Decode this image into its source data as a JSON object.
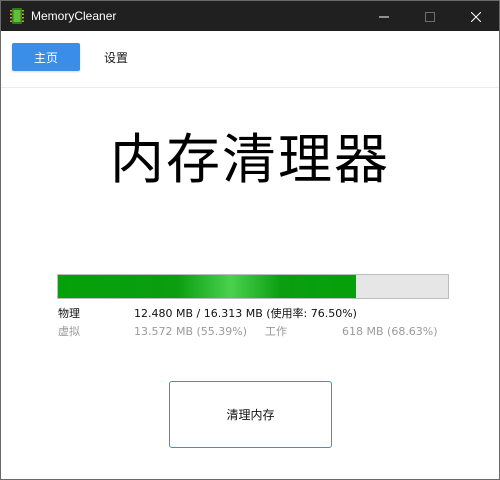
{
  "window": {
    "title": "MemoryCleaner",
    "icon": "memory-chip-icon",
    "controls": [
      "minimize-icon",
      "maximize-icon",
      "close-icon"
    ]
  },
  "tabs": {
    "home_label": "主页",
    "settings_label": "设置",
    "active": "home"
  },
  "main": {
    "title": "内存清理器"
  },
  "memory": {
    "usage_fraction": 0.765,
    "physical_label": "物理",
    "physical_value": "12.480 MB / 16.313 MB (使用率: 76.50%)",
    "virtual_label": "虚拟",
    "virtual_value": "13.572 MB (55.39%)",
    "working_label": "工作",
    "working_value": "618 MB (68.63%)"
  },
  "actions": {
    "clean_label": "清理内存"
  },
  "colors": {
    "accent": "#3b8ee8",
    "progress_green": "#0a9e10",
    "titlebar_bg": "#202020"
  }
}
